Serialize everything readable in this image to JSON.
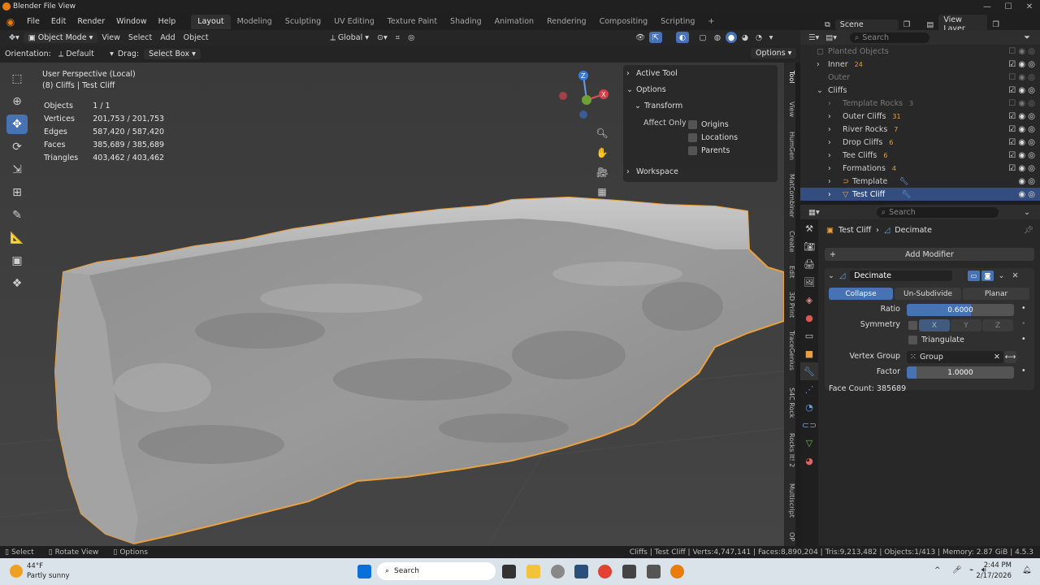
{
  "titlebar": {
    "title": "Blender File View"
  },
  "menu": [
    "File",
    "Edit",
    "Render",
    "Window",
    "Help"
  ],
  "workspaces": [
    "Layout",
    "Modeling",
    "Sculpting",
    "UV Editing",
    "Texture Paint",
    "Shading",
    "Animation",
    "Rendering",
    "Compositing",
    "Scripting"
  ],
  "topright": {
    "scene": "Scene",
    "view_layer": "View Layer"
  },
  "header": {
    "mode": "Object Mode",
    "view": "View",
    "select": "Select",
    "add": "Add",
    "object": "Object",
    "orientation": "Global"
  },
  "toolsettings": {
    "orientation_label": "Orientation:",
    "orientation_value": "Default",
    "drag_label": "Drag:",
    "drag_value": "Select Box",
    "options": "Options"
  },
  "viewport": {
    "line1": "User Perspective (Local)",
    "line2": "(8) Cliffs | Test Cliff",
    "stats": [
      {
        "k": "Objects",
        "v": "1 / 1"
      },
      {
        "k": "Vertices",
        "v": "201,753 / 201,753"
      },
      {
        "k": "Edges",
        "v": "587,420 / 587,420"
      },
      {
        "k": "Faces",
        "v": "385,689 / 385,689"
      },
      {
        "k": "Triangles",
        "v": "403,462 / 403,462"
      }
    ]
  },
  "npanel": {
    "active_tool": "Active Tool",
    "options": "Options",
    "transform": "Transform",
    "affect_only": "Affect Only",
    "origins": "Origins",
    "locations": "Locations",
    "parents": "Parents",
    "workspace": "Workspace"
  },
  "ntabs": [
    "Tool",
    "View",
    "HumGen",
    "MatCombiner",
    "Create",
    "Edit",
    "3D Print",
    "TraceGenius",
    "S4C Rock",
    "Rocks It! 2",
    "Multiscript",
    "OP"
  ],
  "outliner": {
    "search": "Search",
    "rows": [
      {
        "label": "Planted Objects",
        "dim": true
      },
      {
        "label": "Inner",
        "count": "24"
      },
      {
        "label": "Outer",
        "dim": true
      },
      {
        "label": "Cliffs"
      },
      {
        "label": "Template Rocks",
        "count": "3",
        "dim": true
      },
      {
        "label": "Outer Cliffs",
        "count": "31"
      },
      {
        "label": "River Rocks",
        "count": "7"
      },
      {
        "label": "Drop Cliffs",
        "count": "6"
      },
      {
        "label": "Tee Cliffs",
        "count": "6"
      },
      {
        "label": "Formations",
        "count": "4"
      },
      {
        "label": "Template"
      },
      {
        "label": "Test Cliff"
      }
    ]
  },
  "properties": {
    "search": "Search",
    "breadcrumb_obj": "Test Cliff",
    "breadcrumb_mod": "Decimate",
    "add_modifier": "Add Modifier",
    "modifier_name": "Decimate",
    "modes": [
      "Collapse",
      "Un-Subdivide",
      "Planar"
    ],
    "ratio_label": "Ratio",
    "ratio_value": "0.6000",
    "ratio": 0.6,
    "symmetry_label": "Symmetry",
    "axes": [
      "X",
      "Y",
      "Z"
    ],
    "triangulate": "Triangulate",
    "vgroup_label": "Vertex Group",
    "vgroup_value": "Group",
    "factor_label": "Factor",
    "factor_value": "1.0000",
    "face_count": "Face Count: 385689"
  },
  "status": {
    "select": "Select",
    "rotate": "Rotate View",
    "options": "Options",
    "info": "Cliffs | Test Cliff | Verts:4,747,141 | Faces:8,890,204 | Tris:9,213,482 | Objects:1/413 | Memory: 2.87 GiB | 4.5.3"
  },
  "taskbar": {
    "temp": "44°F",
    "weather": "Partly sunny",
    "search": "Search",
    "time": "2:44 PM",
    "date": "2/17/2026"
  }
}
